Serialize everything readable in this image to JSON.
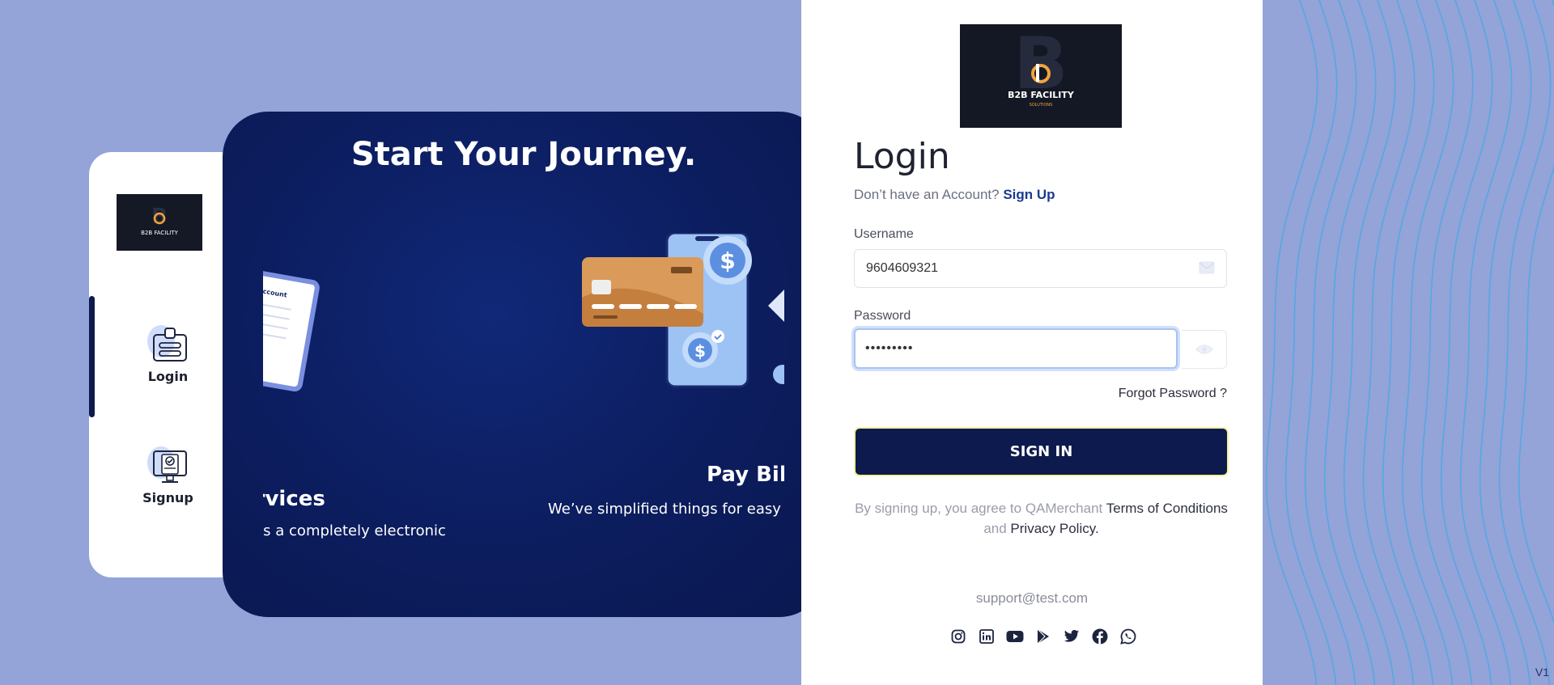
{
  "side_nav": {
    "logo_text": "B2B FACILITY",
    "items": [
      {
        "label": "Login",
        "icon": "login-card-icon"
      },
      {
        "label": "Signup",
        "icon": "signup-monitor-icon"
      }
    ]
  },
  "hero": {
    "title": "Start Your Journey.",
    "slides": [
      {
        "screen_label": "ate Account",
        "heading": "ervices",
        "text": "d as a completely electronic"
      },
      {
        "heading": "Pay Bill Onli",
        "text": "We’ve simplified things for easy & quick p"
      }
    ]
  },
  "login": {
    "logo_text": "B2B FACILITY",
    "logo_subtext": "SOLUTIONS",
    "title": "Login",
    "no_account_text": "Don’t have an Account?",
    "signup_link": "Sign Up",
    "username_label": "Username",
    "username_value": "9604609321",
    "password_label": "Password",
    "password_value": "•••••••••",
    "forgot_label": "Forgot Password ?",
    "signin_label": "SIGN IN",
    "agree_prefix": "By signing up, you agree to QAMerchant",
    "terms_label": "Terms of Conditions",
    "and_label": "and",
    "privacy_label": "Privacy Policy.",
    "support_email": "support@test.com",
    "socials": [
      "instagram-icon",
      "linkedin-icon",
      "youtube-icon",
      "google-play-icon",
      "twitter-icon",
      "facebook-icon",
      "whatsapp-icon"
    ]
  },
  "version": "V1",
  "colors": {
    "background": "#94a3d8",
    "primary_dark": "#0d1a4d",
    "card_blue": "#0c1d5e",
    "link_blue": "#1b3a8f",
    "wave_line": "#4fa9e6"
  }
}
